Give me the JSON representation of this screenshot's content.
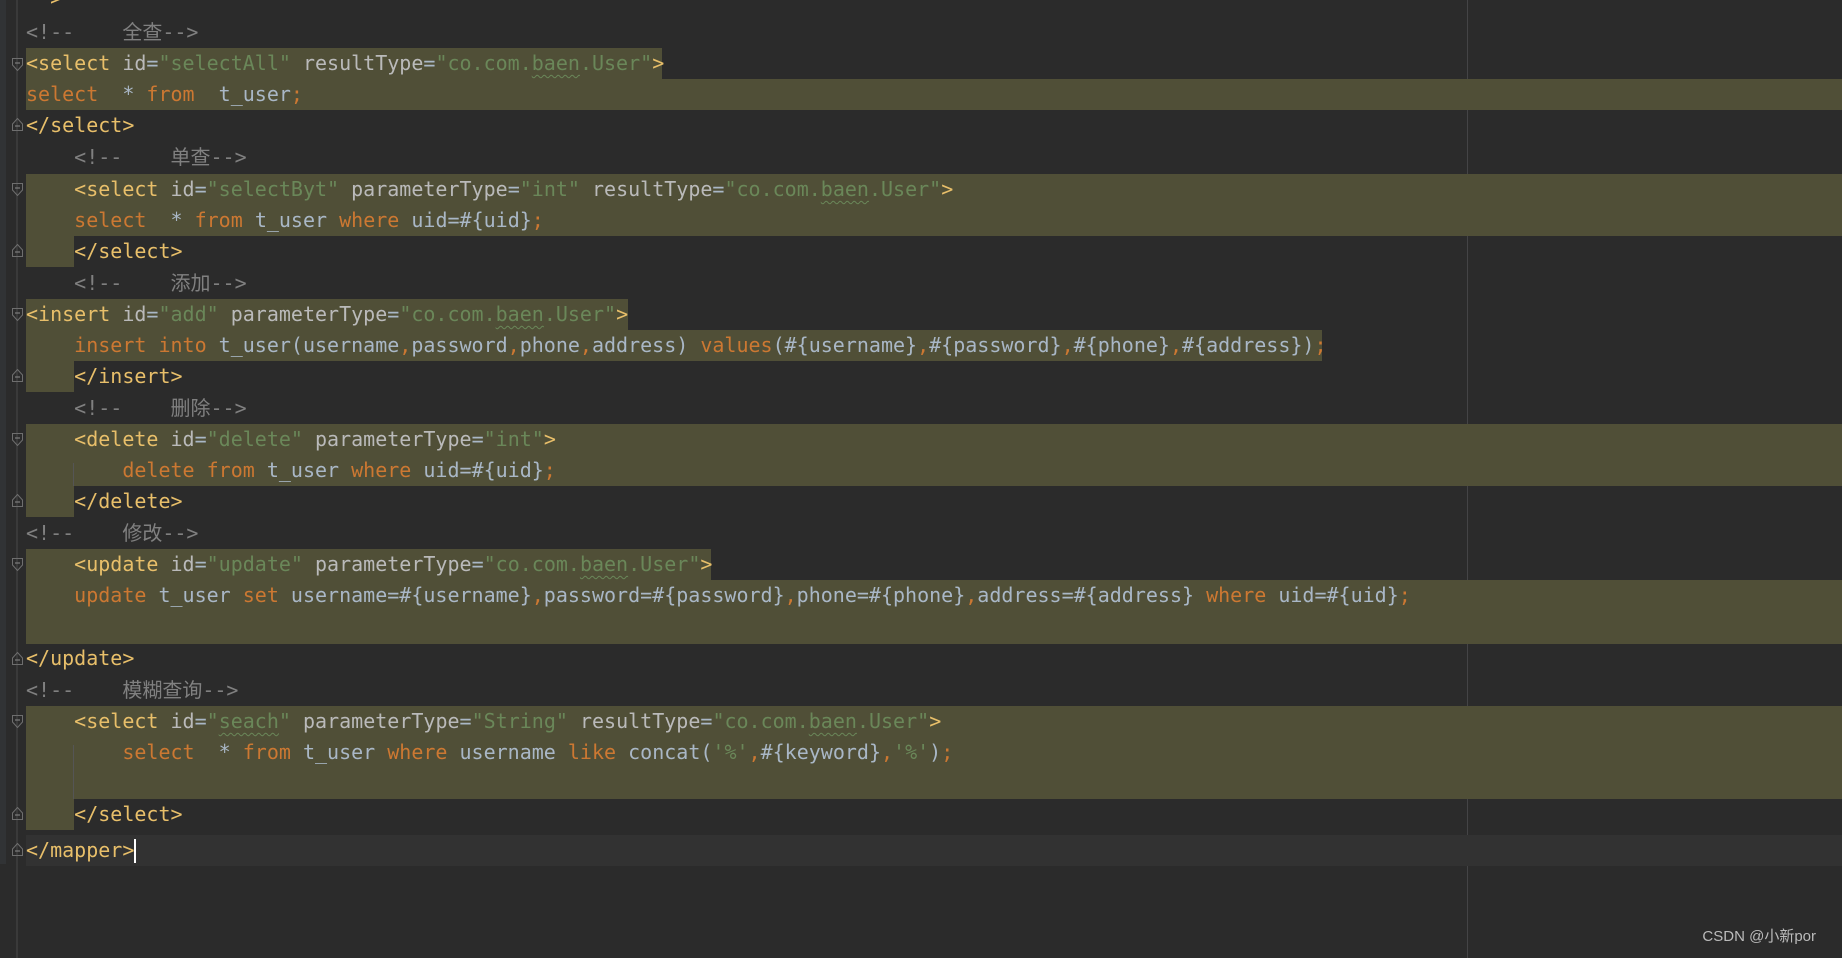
{
  "editor": {
    "top_stub": "-->",
    "lines": [
      {
        "id": "l1",
        "segments": [
          {
            "c": "c",
            "t": "<!--    全查-->"
          }
        ]
      },
      {
        "id": "l2",
        "segments": [
          {
            "c": "t",
            "t": "<select "
          },
          {
            "c": "a",
            "t": "id"
          },
          {
            "c": "p",
            "t": "="
          },
          {
            "c": "v",
            "t": "\"selectAll\" "
          },
          {
            "c": "a",
            "t": "resultType"
          },
          {
            "c": "p",
            "t": "="
          },
          {
            "c": "v",
            "t": "\"co.com."
          },
          {
            "c": "v sq",
            "t": "baen"
          },
          {
            "c": "v",
            "t": ".User\""
          },
          {
            "c": "t",
            "t": ">"
          }
        ]
      },
      {
        "id": "l3",
        "segments": [
          {
            "c": "k",
            "t": "select  "
          },
          {
            "c": "p",
            "t": "* "
          },
          {
            "c": "k",
            "t": "from  "
          },
          {
            "c": "p",
            "t": "t_user"
          },
          {
            "c": "k",
            "t": ";"
          }
        ]
      },
      {
        "id": "l4",
        "segments": [
          {
            "c": "t",
            "t": "</select>"
          }
        ]
      },
      {
        "id": "l5",
        "segments": [
          {
            "c": "c",
            "t": "    <!--    单查-->"
          }
        ]
      },
      {
        "id": "l6",
        "segments": [
          {
            "c": "t",
            "t": "    <select "
          },
          {
            "c": "a",
            "t": "id"
          },
          {
            "c": "p",
            "t": "="
          },
          {
            "c": "v",
            "t": "\"selectByt\" "
          },
          {
            "c": "a",
            "t": "parameterType"
          },
          {
            "c": "p",
            "t": "="
          },
          {
            "c": "v",
            "t": "\"int\" "
          },
          {
            "c": "a",
            "t": "resultType"
          },
          {
            "c": "p",
            "t": "="
          },
          {
            "c": "v",
            "t": "\"co.com."
          },
          {
            "c": "v sq",
            "t": "baen"
          },
          {
            "c": "v",
            "t": ".User\""
          },
          {
            "c": "t",
            "t": ">"
          }
        ]
      },
      {
        "id": "l7",
        "segments": [
          {
            "c": "k",
            "t": "    select  "
          },
          {
            "c": "p",
            "t": "* "
          },
          {
            "c": "k",
            "t": "from "
          },
          {
            "c": "p",
            "t": "t_user "
          },
          {
            "c": "k",
            "t": "where "
          },
          {
            "c": "p",
            "t": "uid=#{uid}"
          },
          {
            "c": "k",
            "t": ";"
          }
        ]
      },
      {
        "id": "l8",
        "segments": [
          {
            "c": "t",
            "t": "    </select>"
          }
        ]
      },
      {
        "id": "l9",
        "segments": [
          {
            "c": "c",
            "t": "    <!--    添加-->"
          }
        ]
      },
      {
        "id": "l10",
        "segments": [
          {
            "c": "t",
            "t": "<insert "
          },
          {
            "c": "a",
            "t": "id"
          },
          {
            "c": "p",
            "t": "="
          },
          {
            "c": "v",
            "t": "\"add\" "
          },
          {
            "c": "a",
            "t": "parameterType"
          },
          {
            "c": "p",
            "t": "="
          },
          {
            "c": "v",
            "t": "\"co.com."
          },
          {
            "c": "v sq",
            "t": "baen"
          },
          {
            "c": "v",
            "t": ".User\""
          },
          {
            "c": "t",
            "t": ">"
          }
        ]
      },
      {
        "id": "l11",
        "segments": [
          {
            "c": "k",
            "t": "    insert into "
          },
          {
            "c": "p",
            "t": "t_user(username"
          },
          {
            "c": "k",
            "t": ","
          },
          {
            "c": "p",
            "t": "password"
          },
          {
            "c": "k",
            "t": ","
          },
          {
            "c": "p",
            "t": "phone"
          },
          {
            "c": "k",
            "t": ","
          },
          {
            "c": "p",
            "t": "address) "
          },
          {
            "c": "k",
            "t": "values"
          },
          {
            "c": "p",
            "t": "(#{username}"
          },
          {
            "c": "k",
            "t": ","
          },
          {
            "c": "p",
            "t": "#{password}"
          },
          {
            "c": "k",
            "t": ","
          },
          {
            "c": "p",
            "t": "#{phone}"
          },
          {
            "c": "k",
            "t": ","
          },
          {
            "c": "p",
            "t": "#{address})"
          },
          {
            "c": "k",
            "t": ";"
          }
        ]
      },
      {
        "id": "l12",
        "segments": [
          {
            "c": "t",
            "t": "    </insert>"
          }
        ]
      },
      {
        "id": "l13",
        "segments": [
          {
            "c": "c",
            "t": "    <!--    删除-->"
          }
        ]
      },
      {
        "id": "l14",
        "segments": [
          {
            "c": "t",
            "t": "    <delete "
          },
          {
            "c": "a",
            "t": "id"
          },
          {
            "c": "p",
            "t": "="
          },
          {
            "c": "v",
            "t": "\"delete\" "
          },
          {
            "c": "a",
            "t": "parameterType"
          },
          {
            "c": "p",
            "t": "="
          },
          {
            "c": "v",
            "t": "\"int\""
          },
          {
            "c": "t",
            "t": ">"
          }
        ]
      },
      {
        "id": "l15",
        "segments": [
          {
            "c": "k",
            "t": "        delete from "
          },
          {
            "c": "p",
            "t": "t_user "
          },
          {
            "c": "k",
            "t": "where "
          },
          {
            "c": "p",
            "t": "uid=#{uid}"
          },
          {
            "c": "k",
            "t": ";"
          }
        ]
      },
      {
        "id": "l16",
        "segments": [
          {
            "c": "t",
            "t": "    </delete>"
          }
        ]
      },
      {
        "id": "l17",
        "segments": [
          {
            "c": "c",
            "t": "<!--    修改-->"
          }
        ]
      },
      {
        "id": "l18",
        "segments": [
          {
            "c": "t",
            "t": "    <update "
          },
          {
            "c": "a",
            "t": "id"
          },
          {
            "c": "p",
            "t": "="
          },
          {
            "c": "v",
            "t": "\"update\" "
          },
          {
            "c": "a",
            "t": "parameterType"
          },
          {
            "c": "p",
            "t": "="
          },
          {
            "c": "v",
            "t": "\"co.com."
          },
          {
            "c": "v sq",
            "t": "baen"
          },
          {
            "c": "v",
            "t": ".User\""
          },
          {
            "c": "t",
            "t": ">"
          }
        ]
      },
      {
        "id": "l19",
        "segments": [
          {
            "c": "k",
            "t": "    update "
          },
          {
            "c": "p",
            "t": "t_user "
          },
          {
            "c": "k",
            "t": "set "
          },
          {
            "c": "p",
            "t": "username=#{username}"
          },
          {
            "c": "k",
            "t": ","
          },
          {
            "c": "p",
            "t": "password=#{password}"
          },
          {
            "c": "k",
            "t": ","
          },
          {
            "c": "p",
            "t": "phone=#{phone}"
          },
          {
            "c": "k",
            "t": ","
          },
          {
            "c": "p",
            "t": "address=#{address} "
          },
          {
            "c": "k",
            "t": "where "
          },
          {
            "c": "p",
            "t": "uid=#{uid}"
          },
          {
            "c": "k",
            "t": ";"
          }
        ]
      },
      {
        "id": "l20",
        "segments": []
      },
      {
        "id": "l21",
        "segments": [
          {
            "c": "t",
            "t": "</update>"
          }
        ]
      },
      {
        "id": "l22",
        "segments": [
          {
            "c": "c",
            "t": "<!--    模糊查询-->"
          }
        ]
      },
      {
        "id": "l23",
        "segments": [
          {
            "c": "t",
            "t": "    <select "
          },
          {
            "c": "a",
            "t": "id"
          },
          {
            "c": "p",
            "t": "="
          },
          {
            "c": "v",
            "t": "\""
          },
          {
            "c": "v sq",
            "t": "seach"
          },
          {
            "c": "v",
            "t": "\" "
          },
          {
            "c": "a",
            "t": "parameterType"
          },
          {
            "c": "p",
            "t": "="
          },
          {
            "c": "v",
            "t": "\"String\" "
          },
          {
            "c": "a",
            "t": "resultType"
          },
          {
            "c": "p",
            "t": "="
          },
          {
            "c": "v",
            "t": "\"co.com."
          },
          {
            "c": "v sq",
            "t": "baen"
          },
          {
            "c": "v",
            "t": ".User\""
          },
          {
            "c": "t",
            "t": ">"
          }
        ]
      },
      {
        "id": "l24",
        "segments": [
          {
            "c": "k",
            "t": "        select  "
          },
          {
            "c": "p",
            "t": "* "
          },
          {
            "c": "k",
            "t": "from "
          },
          {
            "c": "p",
            "t": "t_user "
          },
          {
            "c": "k",
            "t": "where "
          },
          {
            "c": "p",
            "t": "username "
          },
          {
            "c": "k",
            "t": "like "
          },
          {
            "c": "p",
            "t": "concat("
          },
          {
            "c": "v",
            "t": "'%'"
          },
          {
            "c": "k",
            "t": ","
          },
          {
            "c": "p",
            "t": "#{keyword}"
          },
          {
            "c": "k",
            "t": ","
          },
          {
            "c": "v",
            "t": "'%'"
          },
          {
            "c": "p",
            "t": ")"
          },
          {
            "c": "k",
            "t": ";"
          }
        ]
      },
      {
        "id": "l25",
        "segments": []
      },
      {
        "id": "l26",
        "segments": [
          {
            "c": "t",
            "t": "    </select>"
          }
        ]
      },
      {
        "id": "l27",
        "segments": [
          {
            "c": "t",
            "t": "</mapper>"
          }
        ]
      }
    ]
  },
  "watermark": "CSDN @小新por"
}
